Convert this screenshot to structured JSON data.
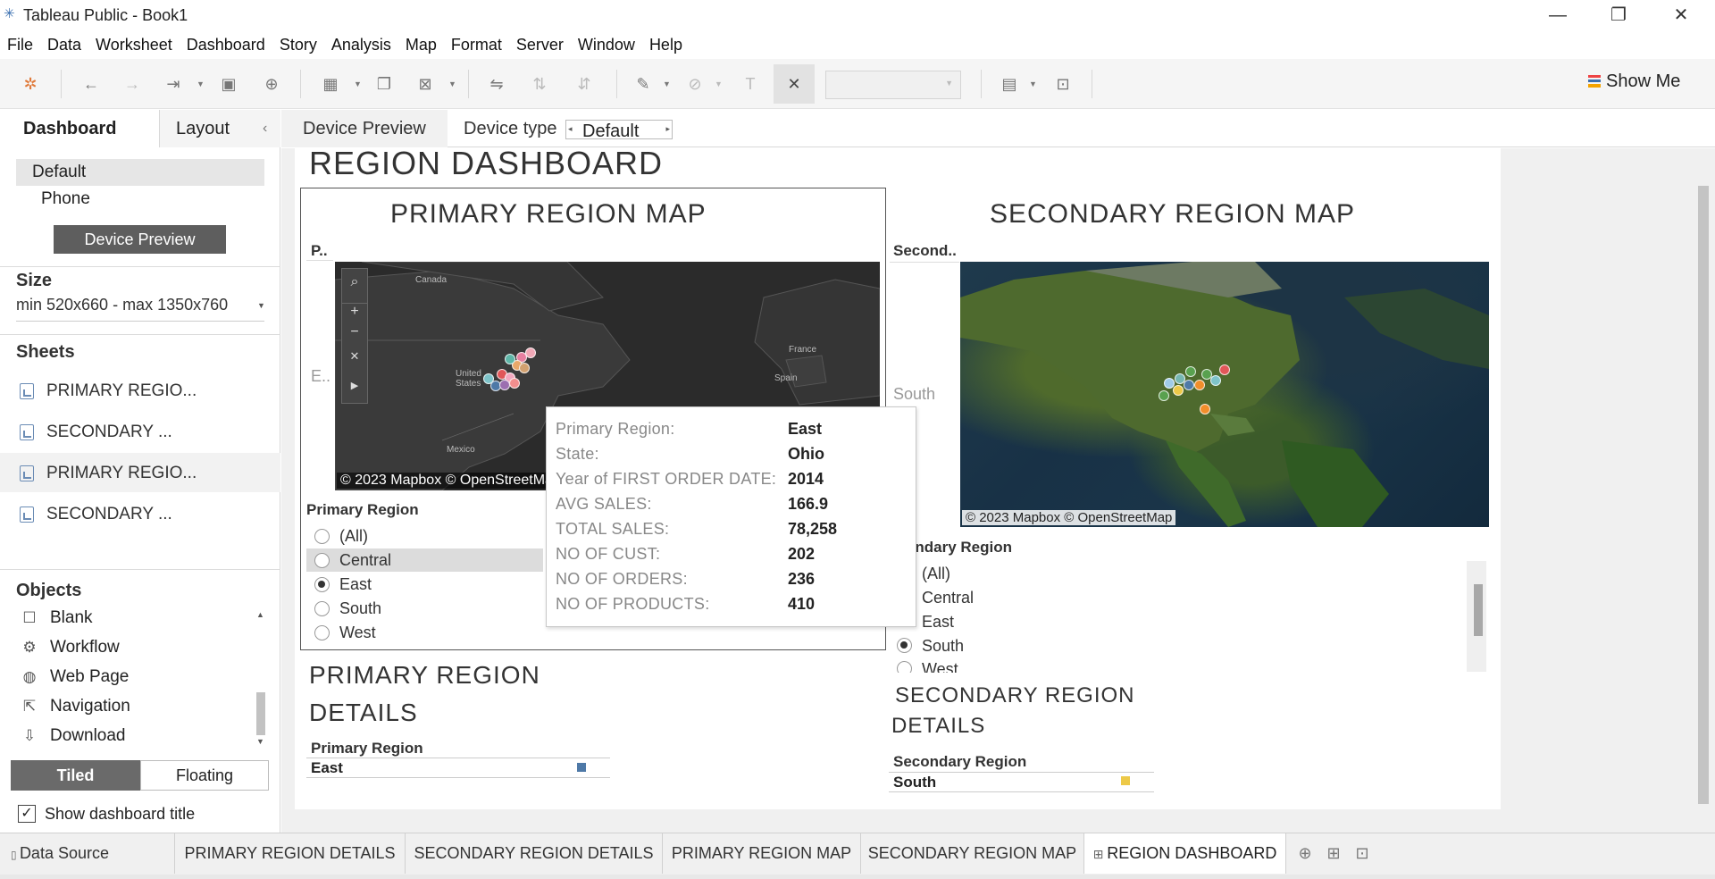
{
  "window": {
    "title": "Tableau Public - Book1",
    "minimize": "—",
    "restore": "❐",
    "close": "✕"
  },
  "menu": [
    "File",
    "Data",
    "Worksheet",
    "Dashboard",
    "Story",
    "Analysis",
    "Map",
    "Format",
    "Server",
    "Window",
    "Help"
  ],
  "toolbar": {
    "show_me": "Show Me"
  },
  "left_panel": {
    "tab_dashboard": "Dashboard",
    "tab_layout": "Layout",
    "devices": [
      "Default",
      "Phone"
    ],
    "device_preview_button": "Device Preview",
    "size_heading": "Size",
    "size_value": "min 520x660 - max 1350x760",
    "sheets_heading": "Sheets",
    "sheets": [
      "PRIMARY REGIO...",
      "SECONDARY ...",
      "PRIMARY REGIO...",
      "SECONDARY ..."
    ],
    "objects_heading": "Objects",
    "objects": [
      "Blank",
      "Workflow",
      "Web Page",
      "Navigation",
      "Download"
    ],
    "tiled": "Tiled",
    "floating": "Floating",
    "show_title_label": "Show dashboard title"
  },
  "device_bar": {
    "device_preview": "Device Preview",
    "device_type_label": "Device type",
    "device_type_value": "Default"
  },
  "dashboard": {
    "title": "REGION DASHBOARD",
    "primary_map": {
      "title": "PRIMARY REGION MAP",
      "row_header": "P..",
      "row_value": "E..",
      "credit": "© 2023 Mapbox © OpenStreetMap",
      "labels": [
        "Canada",
        "United States",
        "Mexico",
        "France",
        "Spain"
      ]
    },
    "secondary_map": {
      "title": "SECONDARY REGION MAP",
      "row_header": "Second..",
      "row_value": "South",
      "credit": "© 2023 Mapbox © OpenStreetMap"
    },
    "primary_filter": {
      "title": "Primary Region",
      "options": [
        "(All)",
        "Central",
        "East",
        "South",
        "West"
      ],
      "selected": "East"
    },
    "secondary_filter": {
      "title": "ondary Region",
      "options": [
        "(All)",
        "Central",
        "East",
        "South",
        "West"
      ],
      "selected": "South"
    },
    "tooltip": [
      {
        "key": "Primary Region:",
        "value": "East"
      },
      {
        "key": "State:",
        "value": "Ohio"
      },
      {
        "key": "Year of FIRST ORDER DATE:",
        "value": "2014"
      },
      {
        "key": "AVG SALES:",
        "value": "166.9"
      },
      {
        "key": "TOTAL SALES:",
        "value": "78,258"
      },
      {
        "key": "NO OF CUST:",
        "value": "202"
      },
      {
        "key": "NO OF ORDERS:",
        "value": "236"
      },
      {
        "key": "NO OF PRODUCTS:",
        "value": "410"
      }
    ],
    "primary_details": {
      "title_line1": "PRIMARY REGION",
      "title_line2": "DETAILS",
      "header": "Primary Region",
      "row": "East",
      "color": "#4e79a7"
    },
    "secondary_details": {
      "title_line1": "SECONDARY REGION",
      "title_line2": "DETAILS",
      "header": "Secondary Region",
      "row": "South",
      "color": "#edc948"
    }
  },
  "bottom_tabs": [
    "Data Source",
    "PRIMARY REGION DETAILS",
    "SECONDARY REGION DETAILS",
    "PRIMARY REGION MAP",
    "SECONDARY REGION MAP",
    "REGION DASHBOARD"
  ],
  "active_tab": "REGION DASHBOARD",
  "colors": {
    "selected_panel": "#e6e6e6",
    "device_preview_btn": "#5e5e5e",
    "tiled_btn": "#6a6a6a"
  }
}
